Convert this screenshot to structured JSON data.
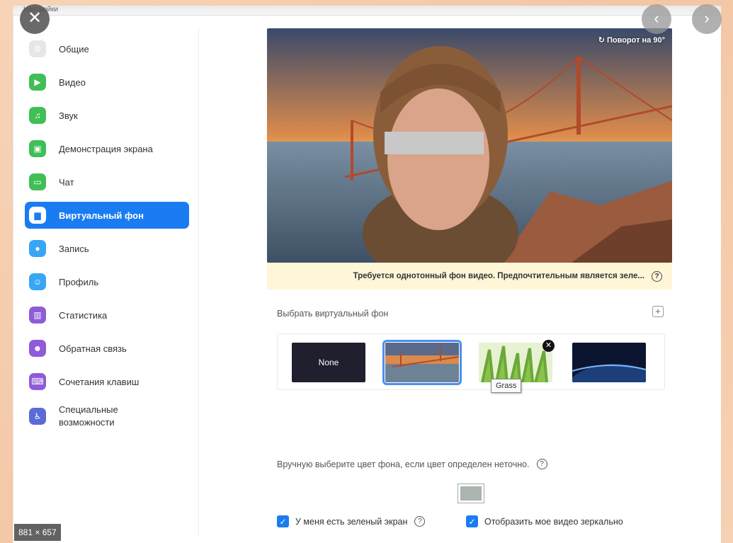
{
  "window": {
    "title": "Настройки"
  },
  "sidebar": {
    "items": [
      {
        "label": "Общие",
        "icon": "gear-icon",
        "color": "#e6e6e6"
      },
      {
        "label": "Видео",
        "icon": "video-icon",
        "color": "#3fbf55"
      },
      {
        "label": "Звук",
        "icon": "headphones-icon",
        "color": "#3fbf55"
      },
      {
        "label": "Демонстрация экрана",
        "icon": "screen-share-icon",
        "color": "#3fbf55"
      },
      {
        "label": "Чат",
        "icon": "chat-icon",
        "color": "#3fbf55"
      },
      {
        "label": "Виртуальный фон",
        "icon": "person-card-icon",
        "color": "#1b7cf2",
        "active": true
      },
      {
        "label": "Запись",
        "icon": "record-icon",
        "color": "#37a6f5"
      },
      {
        "label": "Профиль",
        "icon": "user-icon",
        "color": "#37a6f5"
      },
      {
        "label": "Статистика",
        "icon": "bar-chart-icon",
        "color": "#8f5bd8"
      },
      {
        "label": "Обратная связь",
        "icon": "smile-icon",
        "color": "#8f5bd8"
      },
      {
        "label": "Сочетания клавиш",
        "icon": "keyboard-icon",
        "color": "#8f5bd8"
      },
      {
        "label": "Специальные\nвозможности",
        "icon": "accessibility-icon",
        "color": "#5b6ad8"
      }
    ]
  },
  "preview": {
    "rotate_label": "Поворот на 90°",
    "warning": "Требуется однотонный фон видео. Предпочтительным является зеле..."
  },
  "backgrounds": {
    "title": "Выбрать виртуальный фон",
    "items": [
      {
        "label": "None",
        "kind": "none"
      },
      {
        "label": "Golden Gate",
        "kind": "bridge",
        "selected": true
      },
      {
        "label": "Grass",
        "kind": "grass"
      },
      {
        "label": "Earth",
        "kind": "space"
      }
    ],
    "tooltip": "Grass"
  },
  "manual_color": {
    "label": "Вручную выберите цвет фона, если цвет определен неточно.",
    "swatch_color": "#a9b5ae"
  },
  "options": {
    "green_screen": "У меня есть зеленый экран",
    "mirror": "Отобразить мое видео зеркально"
  },
  "overlay": {
    "size_label": "881 × 657",
    "close_glyph": "✕",
    "prev_glyph": "‹",
    "next_glyph": "›"
  }
}
